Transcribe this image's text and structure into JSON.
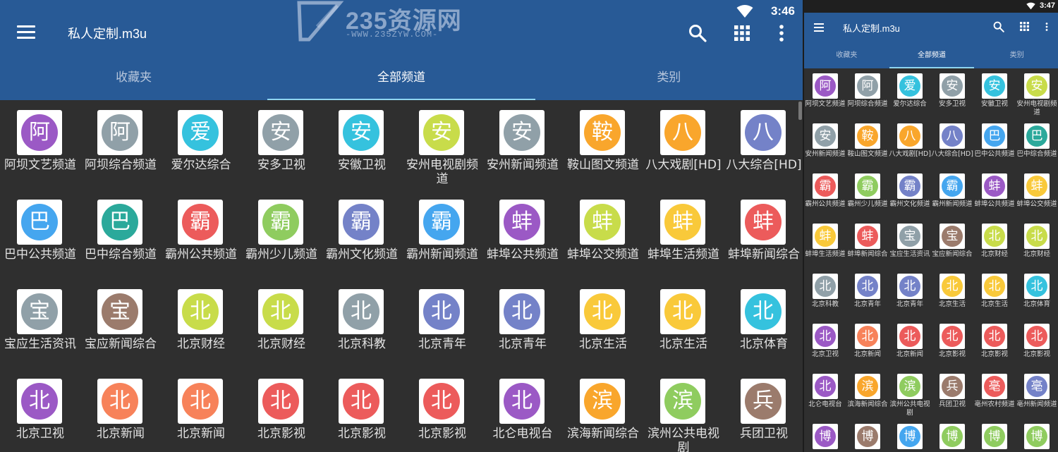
{
  "large": {
    "status_time": "3:46",
    "title": "私人定制.m3u",
    "tabs": [
      {
        "label": "收藏夹",
        "active": false
      },
      {
        "label": "全部频道",
        "active": true
      },
      {
        "label": "类别",
        "active": false
      }
    ]
  },
  "small": {
    "status_time": "3:47",
    "title": "私人定制.m3u",
    "tabs": [
      {
        "label": "收藏夹",
        "active": false
      },
      {
        "label": "全部频道",
        "active": true
      },
      {
        "label": "类别",
        "active": false
      }
    ]
  },
  "watermark": {
    "text": "235资源网",
    "url": "-WWW.235ZYW.COM-"
  },
  "icons": {
    "menu": "hamburger-menu-icon",
    "search": "search-icon",
    "grid": "grid-view-icon",
    "more": "more-vert-icon",
    "wifi": "wifi-icon"
  },
  "colors": {
    "appbar": "#285a96",
    "background": "#2f2f2f",
    "indicator": "#8fd5f0",
    "purple": "#9b59c5",
    "grey": "#90a0a8",
    "cyan": "#35c2de",
    "lime": "#c8dc4a",
    "orange": "#f9a62c",
    "indigo": "#7482c8",
    "sky": "#45a6ef",
    "teal": "#2ba99b",
    "red": "#ec5b5b",
    "green": "#8fcc5f",
    "amber": "#f9c93a",
    "brown": "#9b7b6c",
    "coral": "#f7825a",
    "deeporange": "#f27548"
  },
  "large_channels": [
    {
      "glyph": "阿",
      "color": "purple",
      "name": "阿坝文艺频道"
    },
    {
      "glyph": "阿",
      "color": "grey",
      "name": "阿坝综合频道"
    },
    {
      "glyph": "爱",
      "color": "cyan",
      "name": "爱尔达综合"
    },
    {
      "glyph": "安",
      "color": "grey",
      "name": "安多卫视"
    },
    {
      "glyph": "安",
      "color": "cyan",
      "name": "安徽卫视"
    },
    {
      "glyph": "安",
      "color": "lime",
      "name": "安州电视剧频道"
    },
    {
      "glyph": "安",
      "color": "grey",
      "name": "安州新闻频道"
    },
    {
      "glyph": "鞍",
      "color": "orange",
      "name": "鞍山图文频道"
    },
    {
      "glyph": "八",
      "color": "orange",
      "name": "八大戏剧[HD]"
    },
    {
      "glyph": "八",
      "color": "indigo",
      "name": "八大综合[HD]"
    },
    {
      "glyph": "巴",
      "color": "sky",
      "name": "巴中公共频道"
    },
    {
      "glyph": "巴",
      "color": "teal",
      "name": "巴中综合频道"
    },
    {
      "glyph": "霸",
      "color": "red",
      "name": "霸州公共频道"
    },
    {
      "glyph": "霸",
      "color": "green",
      "name": "霸州少儿频道"
    },
    {
      "glyph": "霸",
      "color": "indigo",
      "name": "霸州文化频道"
    },
    {
      "glyph": "霸",
      "color": "sky",
      "name": "霸州新闻频道"
    },
    {
      "glyph": "蚌",
      "color": "purple",
      "name": "蚌埠公共频道"
    },
    {
      "glyph": "蚌",
      "color": "lime",
      "name": "蚌埠公交频道"
    },
    {
      "glyph": "蚌",
      "color": "amber",
      "name": "蚌埠生活频道"
    },
    {
      "glyph": "蚌",
      "color": "red",
      "name": "蚌埠新闻综合"
    },
    {
      "glyph": "宝",
      "color": "grey",
      "name": "宝应生活资讯"
    },
    {
      "glyph": "宝",
      "color": "brown",
      "name": "宝应新闻综合"
    },
    {
      "glyph": "北",
      "color": "lime",
      "name": "北京财经"
    },
    {
      "glyph": "北",
      "color": "lime",
      "name": "北京财经"
    },
    {
      "glyph": "北",
      "color": "grey",
      "name": "北京科教"
    },
    {
      "glyph": "北",
      "color": "indigo",
      "name": "北京青年"
    },
    {
      "glyph": "北",
      "color": "indigo",
      "name": "北京青年"
    },
    {
      "glyph": "北",
      "color": "amber",
      "name": "北京生活"
    },
    {
      "glyph": "北",
      "color": "amber",
      "name": "北京生活"
    },
    {
      "glyph": "北",
      "color": "cyan",
      "name": "北京体育"
    },
    {
      "glyph": "北",
      "color": "purple",
      "name": "北京卫视"
    },
    {
      "glyph": "北",
      "color": "coral",
      "name": "北京新闻"
    },
    {
      "glyph": "北",
      "color": "coral",
      "name": "北京新闻"
    },
    {
      "glyph": "北",
      "color": "red",
      "name": "北京影视"
    },
    {
      "glyph": "北",
      "color": "red",
      "name": "北京影视"
    },
    {
      "glyph": "北",
      "color": "red",
      "name": "北京影视"
    },
    {
      "glyph": "北",
      "color": "purple",
      "name": "北仑电视台"
    },
    {
      "glyph": "滨",
      "color": "orange",
      "name": "滨海新闻综合"
    },
    {
      "glyph": "滨",
      "color": "green",
      "name": "滨州公共电视剧"
    },
    {
      "glyph": "兵",
      "color": "brown",
      "name": "兵团卫视"
    }
  ],
  "small_channels": [
    {
      "glyph": "阿",
      "color": "purple",
      "name": "阿坝文艺频道"
    },
    {
      "glyph": "阿",
      "color": "grey",
      "name": "阿坝综合频道"
    },
    {
      "glyph": "爱",
      "color": "cyan",
      "name": "爱尔达综合"
    },
    {
      "glyph": "安",
      "color": "grey",
      "name": "安多卫视"
    },
    {
      "glyph": "安",
      "color": "cyan",
      "name": "安徽卫视"
    },
    {
      "glyph": "安",
      "color": "lime",
      "name": "安州电视剧频道"
    },
    {
      "glyph": "安",
      "color": "grey",
      "name": "安州新闻频道"
    },
    {
      "glyph": "鞍",
      "color": "orange",
      "name": "鞍山图文频道"
    },
    {
      "glyph": "八",
      "color": "orange",
      "name": "八大戏剧[HD]"
    },
    {
      "glyph": "八",
      "color": "indigo",
      "name": "八大综合[HD]"
    },
    {
      "glyph": "巴",
      "color": "sky",
      "name": "巴中公共频道"
    },
    {
      "glyph": "巴",
      "color": "teal",
      "name": "巴中综合频道"
    },
    {
      "glyph": "霸",
      "color": "red",
      "name": "霸州公共频道"
    },
    {
      "glyph": "霸",
      "color": "green",
      "name": "霸州少儿频道"
    },
    {
      "glyph": "霸",
      "color": "indigo",
      "name": "霸州文化频道"
    },
    {
      "glyph": "霸",
      "color": "sky",
      "name": "霸州新闻频道"
    },
    {
      "glyph": "蚌",
      "color": "purple",
      "name": "蚌埠公共频道"
    },
    {
      "glyph": "蚌",
      "color": "amber",
      "name": "蚌埠公交频道"
    },
    {
      "glyph": "蚌",
      "color": "amber",
      "name": "蚌埠生活频道"
    },
    {
      "glyph": "蚌",
      "color": "red",
      "name": "蚌埠新闻综合"
    },
    {
      "glyph": "宝",
      "color": "grey",
      "name": "宝应生活资讯"
    },
    {
      "glyph": "宝",
      "color": "brown",
      "name": "宝应新闻综合"
    },
    {
      "glyph": "北",
      "color": "lime",
      "name": "北京财经"
    },
    {
      "glyph": "北",
      "color": "lime",
      "name": "北京财经"
    },
    {
      "glyph": "北",
      "color": "grey",
      "name": "北京科教"
    },
    {
      "glyph": "北",
      "color": "indigo",
      "name": "北京青年"
    },
    {
      "glyph": "北",
      "color": "indigo",
      "name": "北京青年"
    },
    {
      "glyph": "北",
      "color": "amber",
      "name": "北京生活"
    },
    {
      "glyph": "北",
      "color": "amber",
      "name": "北京生活"
    },
    {
      "glyph": "北",
      "color": "cyan",
      "name": "北京体育"
    },
    {
      "glyph": "北",
      "color": "purple",
      "name": "北京卫视"
    },
    {
      "glyph": "北",
      "color": "coral",
      "name": "北京新闻"
    },
    {
      "glyph": "北",
      "color": "red",
      "name": "北京新闻"
    },
    {
      "glyph": "北",
      "color": "red",
      "name": "北京影视"
    },
    {
      "glyph": "北",
      "color": "red",
      "name": "北京影视"
    },
    {
      "glyph": "北",
      "color": "red",
      "name": "北京影视"
    },
    {
      "glyph": "北",
      "color": "purple",
      "name": "北仑电视台"
    },
    {
      "glyph": "滨",
      "color": "orange",
      "name": "滨海新闻综合"
    },
    {
      "glyph": "滨",
      "color": "green",
      "name": "滨州公共电视剧"
    },
    {
      "glyph": "兵",
      "color": "brown",
      "name": "兵团卫视"
    },
    {
      "glyph": "亳",
      "color": "red",
      "name": "亳州农村频道"
    },
    {
      "glyph": "亳",
      "color": "indigo",
      "name": "亳州新闻频道"
    },
    {
      "glyph": "博",
      "color": "purple",
      "name": ""
    },
    {
      "glyph": "博",
      "color": "brown",
      "name": ""
    },
    {
      "glyph": "博",
      "color": "sky",
      "name": ""
    },
    {
      "glyph": "博",
      "color": "green",
      "name": ""
    },
    {
      "glyph": "博",
      "color": "green",
      "name": ""
    },
    {
      "glyph": "博",
      "color": "green",
      "name": ""
    }
  ]
}
